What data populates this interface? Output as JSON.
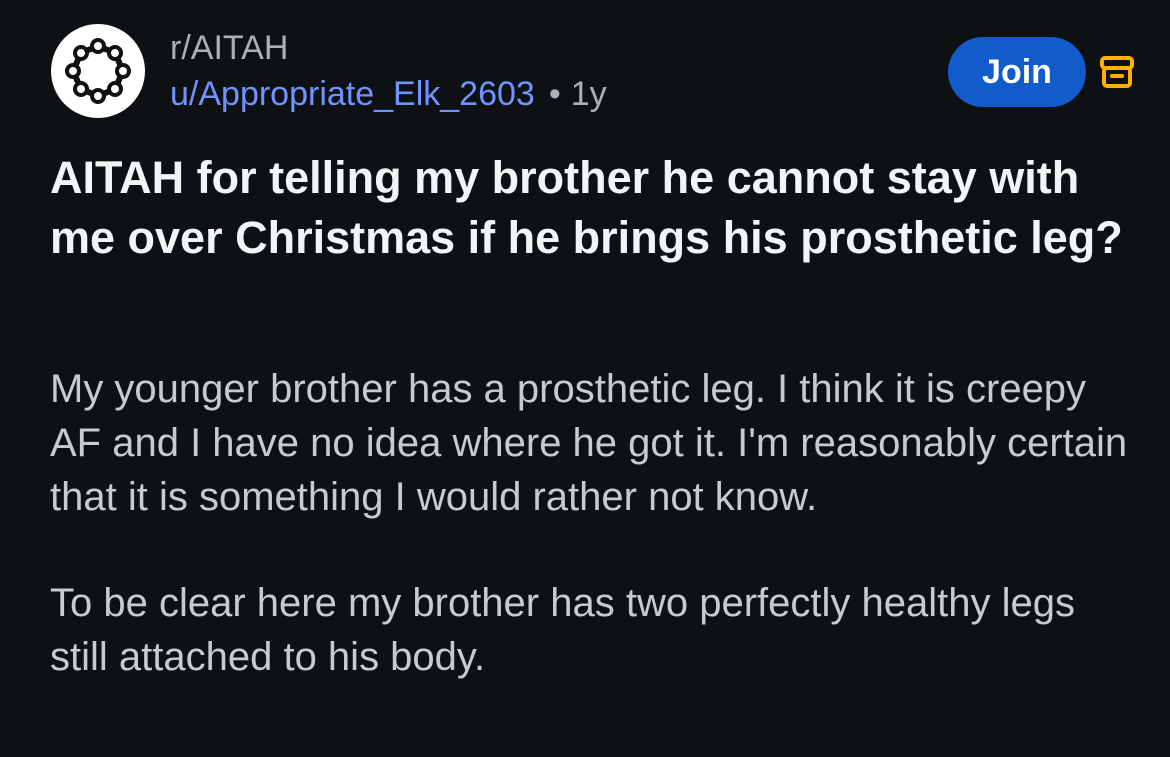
{
  "post": {
    "subreddit": "r/AITAH",
    "author": "u/Appropriate_Elk_2603",
    "separator": "•",
    "age": "1y",
    "join_label": "Join",
    "title": "AITAH for telling my brother he cannot stay with me over Christmas if he brings his prosthetic leg?",
    "paragraphs": [
      "My younger brother has a prosthetic leg. I think it is creepy AF and I have no idea where he got it. I'm reasonably certain that it is something I would rather not know.",
      "To be clear here my brother has two perfectly healthy legs still attached to his body."
    ]
  },
  "icons": {
    "avatar": "subreddit-network-logo-icon",
    "archive": "archive-box-icon"
  },
  "colors": {
    "background": "#0e1113",
    "join_button": "#115bca",
    "username": "#7193ff",
    "archive_icon": "#ffb000"
  }
}
